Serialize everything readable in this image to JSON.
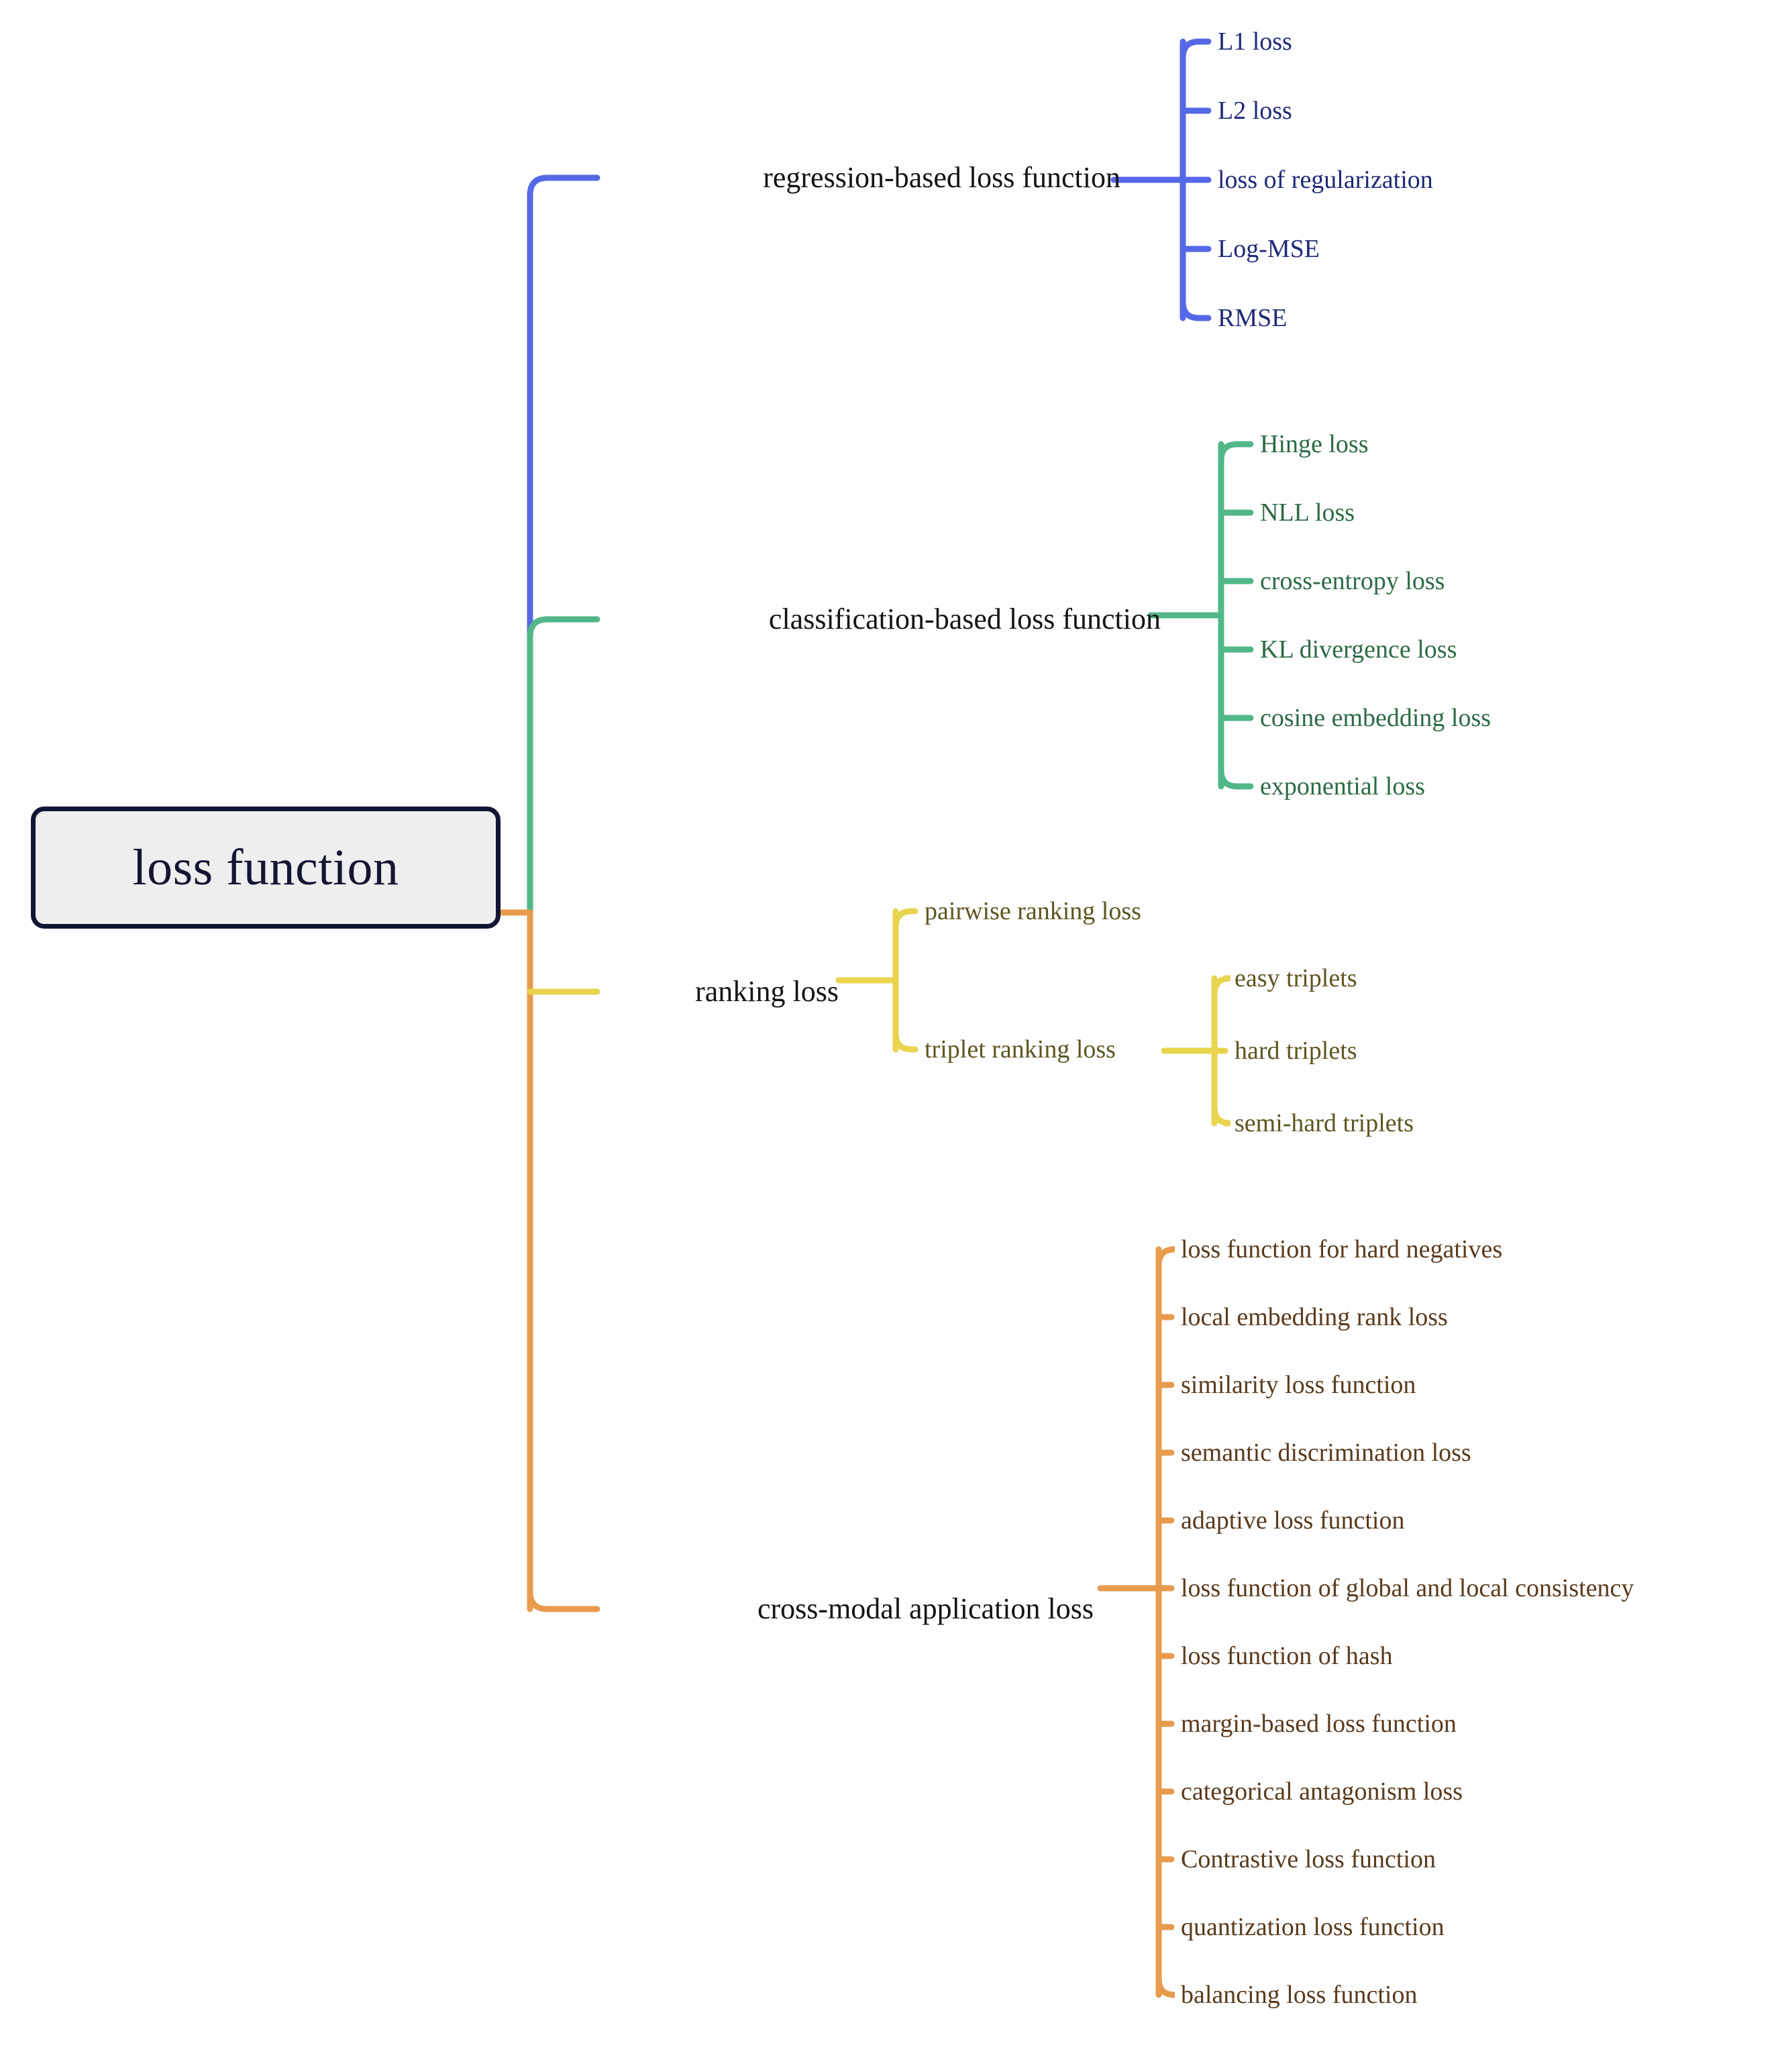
{
  "diagram": {
    "type": "mind-map",
    "title": "loss function",
    "background": "#fefefe",
    "root": {
      "label": "loss function",
      "fill": "#eeeeee",
      "border_color": "#141433",
      "text_color": "#141433"
    },
    "branches": [
      {
        "id": "regression",
        "label": "regression-based loss function",
        "color": "#5468e8",
        "text_color": "#1e2a78",
        "children": [
          {
            "label": "L1 loss"
          },
          {
            "label": "L2 loss"
          },
          {
            "label": "loss of regularization"
          },
          {
            "label": "Log-MSE"
          },
          {
            "label": "RMSE"
          }
        ]
      },
      {
        "id": "classification",
        "label": "classification-based loss function",
        "color": "#52b788",
        "text_color": "#2c6b43",
        "children": [
          {
            "label": "Hinge loss"
          },
          {
            "label": "NLL loss"
          },
          {
            "label": "cross-entropy loss"
          },
          {
            "label": "KL divergence loss"
          },
          {
            "label": "cosine embedding loss"
          },
          {
            "label": "exponential loss"
          }
        ]
      },
      {
        "id": "ranking",
        "label": "ranking loss",
        "color": "#e8d44d",
        "text_color": "#5f5520",
        "children": [
          {
            "label": "pairwise ranking loss",
            "children": []
          },
          {
            "label": "triplet ranking loss",
            "children": [
              {
                "label": "easy triplets"
              },
              {
                "label": "hard triplets"
              },
              {
                "label": "semi-hard triplets"
              }
            ]
          }
        ]
      },
      {
        "id": "cross-modal",
        "label": "cross-modal application loss",
        "color": "#e89b4d",
        "text_color": "#5a3a1c",
        "children": [
          {
            "label": "loss function for hard negatives"
          },
          {
            "label": "local embedding rank loss"
          },
          {
            "label": "similarity loss function"
          },
          {
            "label": "semantic discrimination loss"
          },
          {
            "label": "adaptive loss function"
          },
          {
            "label": "loss function of global and local consistency"
          },
          {
            "label": "loss function of hash"
          },
          {
            "label": "margin-based loss function"
          },
          {
            "label": "categorical antagonism loss"
          },
          {
            "label": "Contrastive loss function"
          },
          {
            "label": "quantization loss function"
          },
          {
            "label": "balancing loss function"
          }
        ]
      }
    ]
  }
}
